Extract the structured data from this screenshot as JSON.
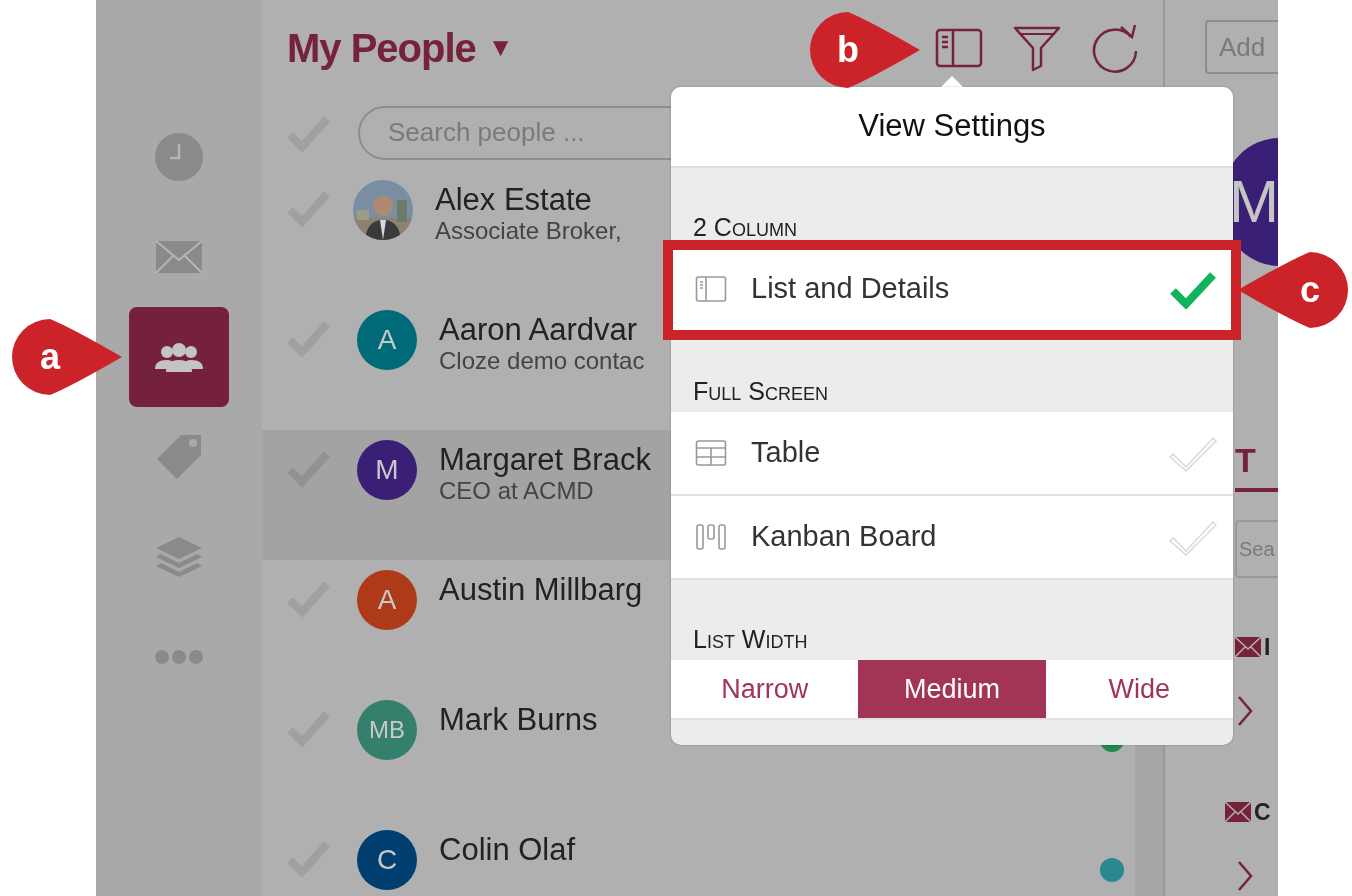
{
  "sidebar": {
    "items": [
      {
        "kind": "clock",
        "selected": false
      },
      {
        "kind": "mail",
        "selected": false
      },
      {
        "kind": "people",
        "selected": true
      },
      {
        "kind": "tag",
        "selected": false
      },
      {
        "kind": "layers",
        "selected": false
      },
      {
        "kind": "more",
        "selected": false
      }
    ]
  },
  "header": {
    "title": "My People",
    "caret": "▼"
  },
  "search": {
    "placeholder": "Search people ..."
  },
  "people": [
    {
      "name": "Alex Estate",
      "subtitle": "Associate Broker,",
      "selected": false
    },
    {
      "name": "Aaron Aardvar",
      "subtitle": "Cloze demo contac",
      "avatar": {
        "kind": "initials",
        "initials": "A",
        "color": "#006b78"
      },
      "selected": false
    },
    {
      "name": "Margaret Brack",
      "subtitle": "CEO at ACMD",
      "avatar": {
        "kind": "initials",
        "initials": "M",
        "color": "#3a1f76"
      },
      "selected": true
    },
    {
      "name": "Austin Millbarg",
      "avatar": {
        "kind": "initials",
        "initials": "A",
        "color": "#ad3a18"
      },
      "selected": false
    },
    {
      "name": "Mark Burns",
      "avatar": {
        "kind": "initials",
        "initials": "MB",
        "color": "#35806c"
      },
      "selected": false,
      "status_dot": {
        "color": "#1f8a4c"
      }
    },
    {
      "name": "Colin Olaf",
      "avatar": {
        "kind": "initials",
        "initials": "C",
        "color": "#003f70"
      },
      "selected": false,
      "status_dot": {
        "color": "#2a8890"
      }
    }
  ],
  "details": {
    "add_field": {
      "placeholder": "Add"
    },
    "avatar": {
      "initials": "M",
      "color": "#3a1f76"
    },
    "tab": "T",
    "search": {
      "placeholder": "Sea"
    },
    "items": [
      {
        "title": "I"
      },
      {
        "title": "C"
      }
    ]
  },
  "view_settings": {
    "title": "View Settings",
    "sections": [
      {
        "header": "2 Column",
        "options": [
          {
            "kind": "list-details",
            "label": "List and Details",
            "selected": true,
            "highlighted": true
          }
        ]
      },
      {
        "header": "Full Screen",
        "options": [
          {
            "kind": "table",
            "label": "Table",
            "selected": false
          },
          {
            "kind": "kanban",
            "label": "Kanban Board",
            "selected": false
          }
        ]
      },
      {
        "header": "List Width",
        "segments": [
          {
            "label": "Narrow",
            "selected": false
          },
          {
            "label": "Medium",
            "selected": true
          },
          {
            "label": "Wide",
            "selected": false
          }
        ]
      }
    ]
  },
  "callouts": [
    {
      "label": "a"
    },
    {
      "label": "b"
    },
    {
      "label": "c"
    }
  ]
}
